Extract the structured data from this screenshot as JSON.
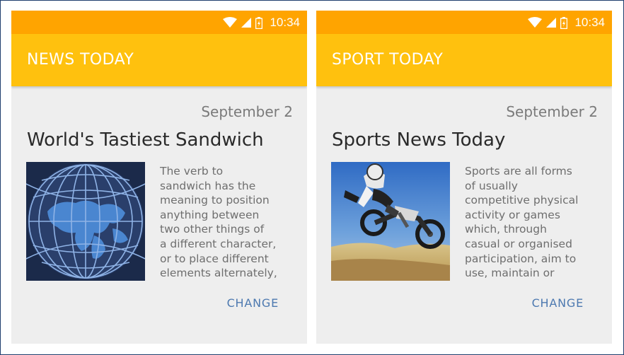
{
  "status_time": "10:34",
  "colors": {
    "status_bar": "#ffa400",
    "toolbar": "#ffc10e",
    "background": "#eeeeee",
    "accent_link": "#4d79b0"
  },
  "panels": [
    {
      "title": "NEWS TODAY",
      "date": "September 2",
      "headline": "World's Tastiest Sandwich",
      "body": "The verb to\nsandwich has the\nmeaning to position\nanything between\ntwo other things of\na different character,\nor to place different\nelements alternately,",
      "image": "globe-grid-image",
      "button": "CHANGE"
    },
    {
      "title": "SPORT TODAY",
      "date": "September 2",
      "headline": "Sports News Today",
      "body": "Sports are all forms\nof usually\ncompetitive physical\nactivity or games\nwhich, through\ncasual or organised\nparticipation, aim to\nuse, maintain or",
      "image": "motocross-jump-image",
      "button": "CHANGE"
    }
  ]
}
